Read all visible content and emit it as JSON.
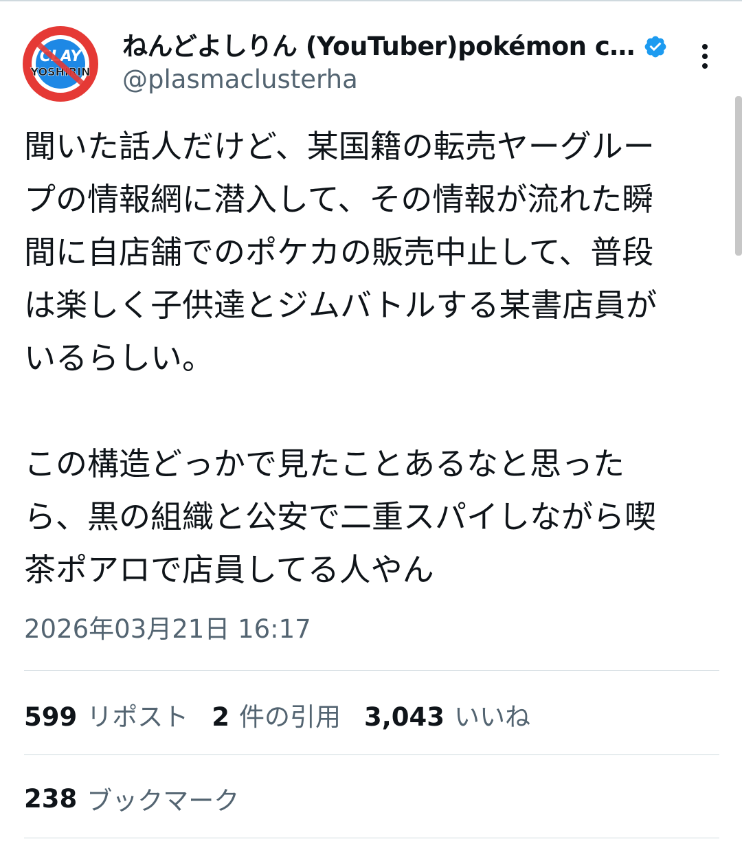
{
  "tweet": {
    "author": {
      "display_name": "ねんどよしりん (YouTuber)pokémon cl…",
      "handle": "@plasmaclusterha",
      "avatar_text_top": "CLAY",
      "avatar_text_bottom": "YOSHIRIN",
      "verified": true,
      "verified_color": "#1d9bf0",
      "avatar_ring_color": "#e53935",
      "avatar_inner_color": "#1e88e5"
    },
    "more_icon": "more-vertical-icon",
    "text": "聞いた話人だけど、某国籍の転売ヤーグルー\nプの情報網に潜入して、その情報が流れた瞬\n間に自店舗でのポケカの販売中止して、普段\nは楽しく子供達とジムバトルする某書店員が\nいるらしい。\n\nこの構造どっかで見たことあるなと思った\nら、黒の組織と公安で二重スパイしながら喫\n茶ポアロで店員してる人やん",
    "timestamp": "2026年03月21日 16:17",
    "stats": {
      "reposts": {
        "count": "599",
        "label": "リポスト"
      },
      "quotes": {
        "count": "2",
        "label": "件の引用"
      },
      "likes": {
        "count": "3,043",
        "label": "いいね"
      },
      "bookmarks": {
        "count": "238",
        "label": "ブックマーク"
      }
    }
  }
}
